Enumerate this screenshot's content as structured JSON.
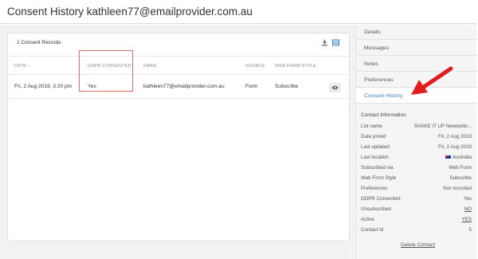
{
  "header": {
    "title": "Consent History kathleen77@emailprovider.com.au"
  },
  "records": {
    "count_label": "1 Consent Records",
    "icons": [
      "download-icon",
      "columns-icon"
    ],
    "columns": [
      "DATE",
      "GDPR CONSENTED",
      "EMAIL",
      "SOURCE",
      "WEB FORM STYLE"
    ],
    "sort_indicator": "–",
    "rows": [
      {
        "date": "Fri, 2 Aug 2019, 3:20 pm",
        "gdpr": "Yes",
        "email": "kathleen77@emailprovider.com.au",
        "source": "Form",
        "style": "Subscribe"
      }
    ]
  },
  "sidebar": {
    "nav": [
      "Details",
      "Messages",
      "Notes",
      "Preferences",
      "Consent History"
    ],
    "active": "Consent History",
    "contact_title": "Contact Information",
    "info": [
      {
        "key": "List name",
        "value": "SHAKE IT UP Newslette..."
      },
      {
        "key": "Date joined",
        "value": "Fri, 2 Aug 2019"
      },
      {
        "key": "Last updated",
        "value": "Fri, 2 Aug 2019"
      },
      {
        "key": "Last location",
        "value": "Australia"
      },
      {
        "key": "Subscribed via",
        "value": "Web Form"
      },
      {
        "key": "Web Form Style",
        "value": "Subscribe"
      },
      {
        "key": "Preferences",
        "value": "Not recorded"
      },
      {
        "key": "GDPR Consented",
        "value": "Yes"
      },
      {
        "key": "Unsubscribed",
        "value": "NO"
      },
      {
        "key": "Active",
        "value": "YES"
      },
      {
        "key": "Contact Id",
        "value": "5"
      }
    ],
    "delete_label": "Delete Contact"
  },
  "colors": {
    "accent": "#3d7fc4",
    "highlight_box": "#e06b6b",
    "arrow": "#e11d1d"
  }
}
